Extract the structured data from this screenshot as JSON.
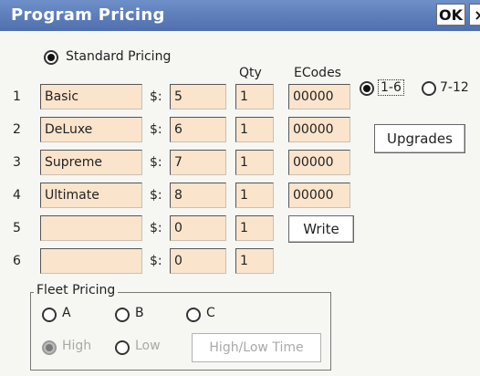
{
  "window": {
    "title": "Program Pricing",
    "ok_label": "OK",
    "close_label": "×"
  },
  "standard_pricing_label": "Standard Pricing",
  "headers": {
    "qty": "Qty",
    "ecodes": "ECodes"
  },
  "currency_label": "$:",
  "rows": [
    {
      "num": "1",
      "name": "Basic",
      "price": "5",
      "qty": "1",
      "ecode": "00000"
    },
    {
      "num": "2",
      "name": "DeLuxe",
      "price": "6",
      "qty": "1",
      "ecode": "00000"
    },
    {
      "num": "3",
      "name": "Supreme",
      "price": "7",
      "qty": "1",
      "ecode": "00000"
    },
    {
      "num": "4",
      "name": "Ultimate",
      "price": "8",
      "qty": "1",
      "ecode": "00000"
    },
    {
      "num": "5",
      "name": "",
      "price": "0",
      "qty": "1"
    },
    {
      "num": "6",
      "name": "",
      "price": "0",
      "qty": "1"
    }
  ],
  "write_label": "Write",
  "range": {
    "option1": "1-6",
    "option2": "7-12",
    "selected": "1-6"
  },
  "upgrades_label": "Upgrades",
  "fleet": {
    "title": "Fleet Pricing",
    "options": [
      "A",
      "B",
      "C"
    ],
    "high_label": "High",
    "low_label": "Low",
    "high_low_time_label": "High/Low Time"
  }
}
